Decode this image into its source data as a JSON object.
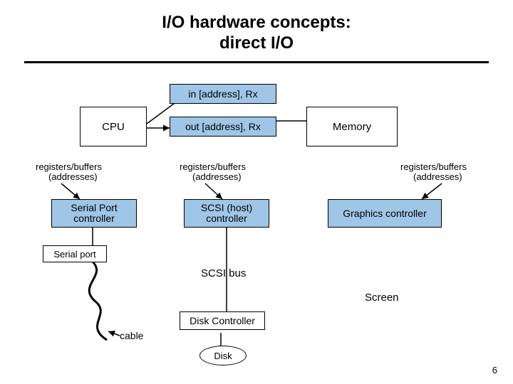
{
  "title_line1": "I/O hardware concepts:",
  "title_line2": "direct I/O",
  "in_instr": "in [address], Rx",
  "out_instr": "out [address], Rx",
  "cpu": "CPU",
  "memory": "Memory",
  "regbuf": "registers/buffers",
  "addresses": "(addresses)",
  "serial_port_ctrl_l1": "Serial Port",
  "serial_port_ctrl_l2": "controller",
  "scsi_ctrl_l1": "SCSI (host)",
  "scsi_ctrl_l2": "controller",
  "graphics_ctrl": "Graphics controller",
  "serial_port": "Serial port",
  "scsi_bus": "SCSI bus",
  "screen": "Screen",
  "disk_ctrl": "Disk Controller",
  "disk": "Disk",
  "cable": "cable",
  "page": "6"
}
